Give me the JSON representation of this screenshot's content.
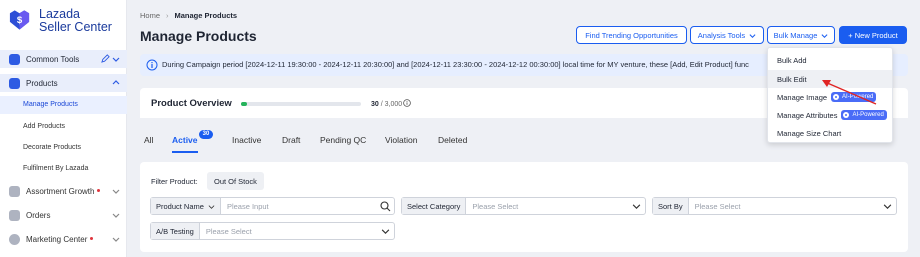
{
  "brand": {
    "line1": "Lazada",
    "line2": "Seller Center"
  },
  "sidebar": {
    "common_tools": "Common Tools",
    "products": "Products",
    "product_items": [
      "Manage Products",
      "Add Products",
      "Decorate Products",
      "Fulfilment By Lazada"
    ],
    "assortment_growth": "Assortment Growth",
    "orders": "Orders",
    "marketing_center": "Marketing Center"
  },
  "breadcrumb": {
    "home": "Home",
    "separator": "›",
    "current": "Manage Products"
  },
  "page_title": "Manage Products",
  "header_buttons": {
    "trending": "Find Trending Opportunities",
    "analysis": "Analysis Tools",
    "bulk_manage": "Bulk Manage",
    "new_product": "+ New Product"
  },
  "notice": "During Campaign period [2024-12-11 19:30:00 - 2024-12-11 20:30:00] and [2024-12-11 23:30:00 - 2024-12-12 00:30:00] local time for MY venture, these [Add, Edit Product] func",
  "overview": {
    "title": "Product Overview",
    "count": "30",
    "total": "/ 3,000",
    "progress_fraction": 0.01
  },
  "tabs": [
    {
      "label": "All"
    },
    {
      "label": "Active",
      "badge": "30"
    },
    {
      "label": "Inactive"
    },
    {
      "label": "Draft"
    },
    {
      "label": "Pending QC"
    },
    {
      "label": "Violation"
    },
    {
      "label": "Deleted"
    }
  ],
  "filters": {
    "filter_product_label": "Filter Product:",
    "chip": "Out Of Stock",
    "product_name_label": "Product Name",
    "product_name_placeholder": "Please Input",
    "category_label": "Select Category",
    "category_placeholder": "Please Select",
    "sort_label": "Sort By",
    "sort_placeholder": "Please Select",
    "ab_label": "A/B Testing",
    "ab_placeholder": "Please Select"
  },
  "bulk_menu": {
    "items": [
      "Bulk Add",
      "Bulk Edit",
      "Manage Image",
      "Manage Attributes",
      "Manage Size Chart"
    ],
    "ai_badge": "AI-Powered"
  },
  "colors": {
    "accent": "#1a5df0",
    "brand": "#1a3a9c",
    "progress": "#25b35b",
    "notice_bg": "#e6eeff",
    "annotation_arrow": "#e02424"
  }
}
